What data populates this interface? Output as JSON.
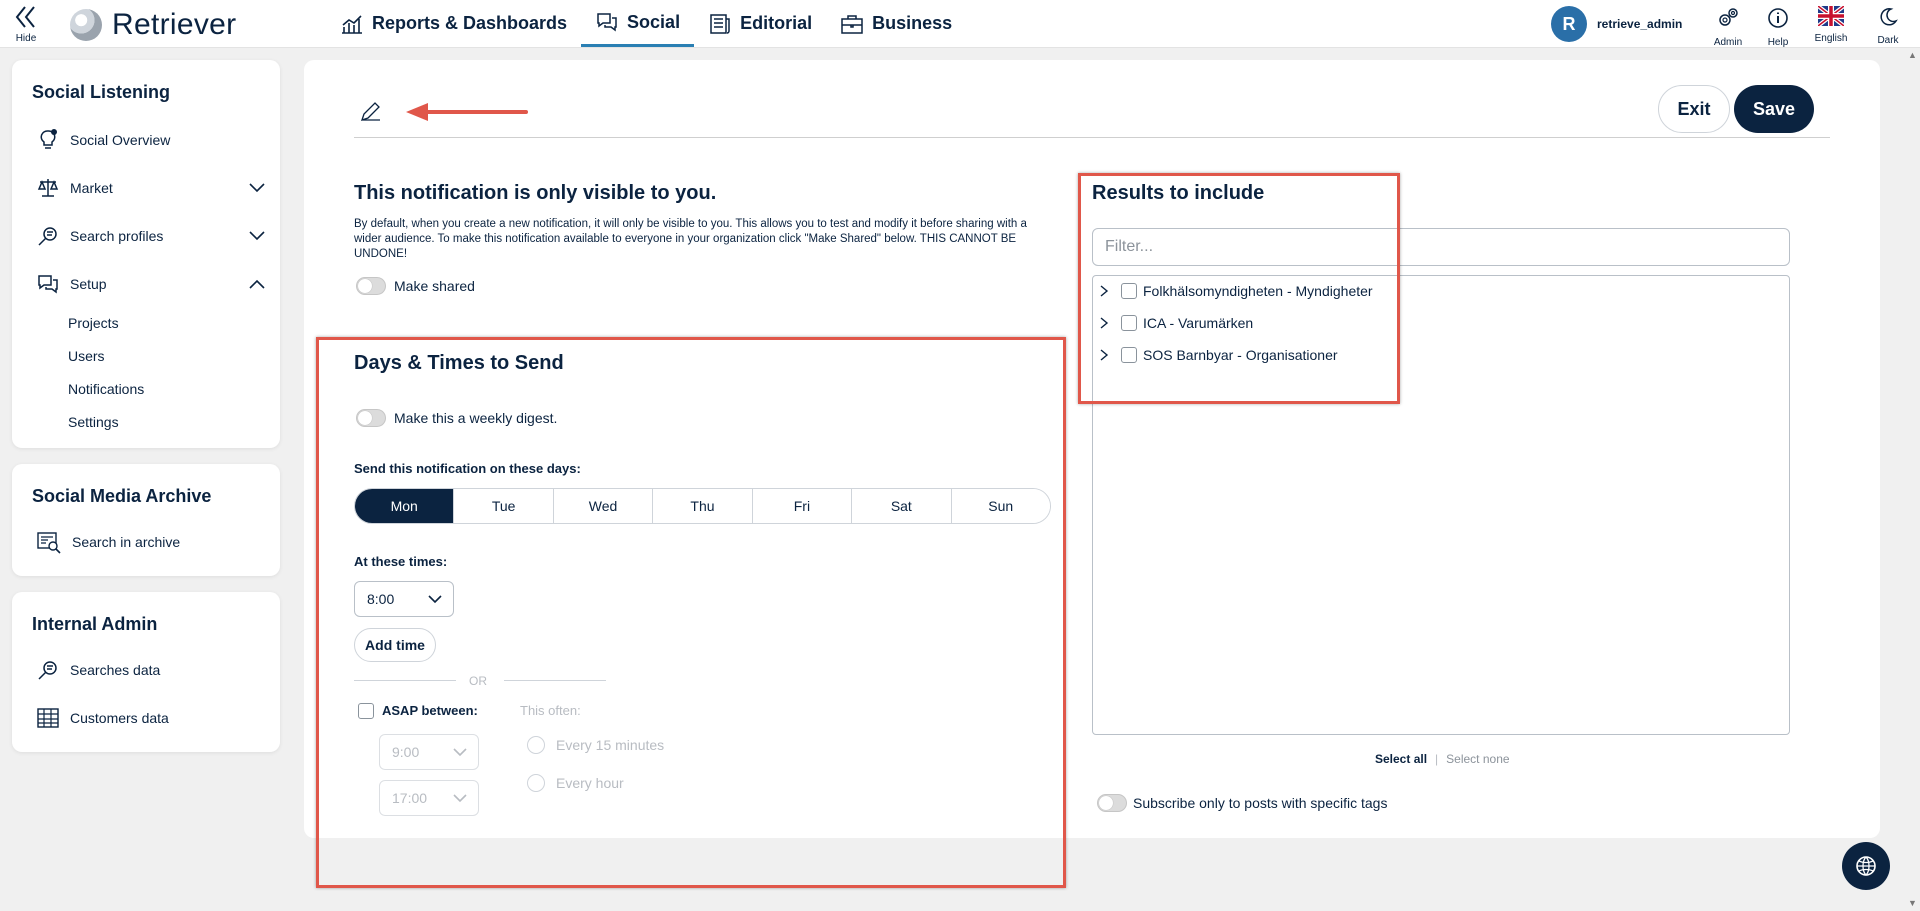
{
  "topbar": {
    "hide_label": "Hide",
    "brand": "Retriever",
    "nav": [
      {
        "label": "Reports & Dashboards",
        "icon": "chart-icon"
      },
      {
        "label": "Social",
        "icon": "chat-icon",
        "active": true
      },
      {
        "label": "Editorial",
        "icon": "newspaper-icon"
      },
      {
        "label": "Business",
        "icon": "briefcase-icon"
      }
    ],
    "user_initial": "R",
    "username": "retrieve_admin",
    "tools": {
      "admin": "Admin",
      "help": "Help",
      "english": "English",
      "dark": "Dark"
    }
  },
  "sidebar": {
    "social_listening": {
      "title": "Social Listening",
      "items": {
        "overview": "Social Overview",
        "market": "Market",
        "search_profiles": "Search profiles",
        "setup": "Setup"
      },
      "setup_sub": {
        "projects": "Projects",
        "users": "Users",
        "notifications": "Notifications",
        "settings": "Settings"
      }
    },
    "archive": {
      "title": "Social Media Archive",
      "search": "Search in archive"
    },
    "admin": {
      "title": "Internal Admin",
      "searches": "Searches data",
      "customers": "Customers data"
    }
  },
  "main": {
    "exit_label": "Exit",
    "save_label": "Save",
    "visibility": {
      "title": "This notification is only visible to you.",
      "description": "By default, when you create a new notification, it will only be visible to you. This allows you to test and modify it before sharing with a wider audience. To make this notification available to everyone in your organization click \"Make Shared\" below. THIS CANNOT BE UNDONE!",
      "make_shared": "Make shared"
    },
    "schedule": {
      "title": "Days & Times to Send",
      "weekly_digest": "Make this a weekly digest.",
      "days_label": "Send this notification on these days:",
      "days": {
        "mon": "Mon",
        "tue": "Tue",
        "wed": "Wed",
        "thu": "Thu",
        "fri": "Fri",
        "sat": "Sat",
        "sun": "Sun"
      },
      "selected_day": "Mon",
      "times_label": "At these times:",
      "time_value": "8:00",
      "add_time": "Add time",
      "or": "OR",
      "asap": "ASAP between:",
      "this_often": "This often:",
      "from": "9:00",
      "to": "17:00",
      "every_15": "Every 15 minutes",
      "every_hour": "Every hour"
    },
    "results": {
      "title": "Results to include",
      "filter_placeholder": "Filter...",
      "items": {
        "a": "Folkhälsomyndigheten - Myndigheter",
        "b": "ICA - Varumärken",
        "c": "SOS Barnbyar - Organisationer"
      },
      "select_all": "Select all",
      "separator": "|",
      "select_none": "Select none",
      "subscribe_tags": "Subscribe only to posts with specific tags"
    }
  },
  "colors": {
    "navy": "#0b2340",
    "accent": "#2a7fb3",
    "highlight": "#e0574a"
  }
}
